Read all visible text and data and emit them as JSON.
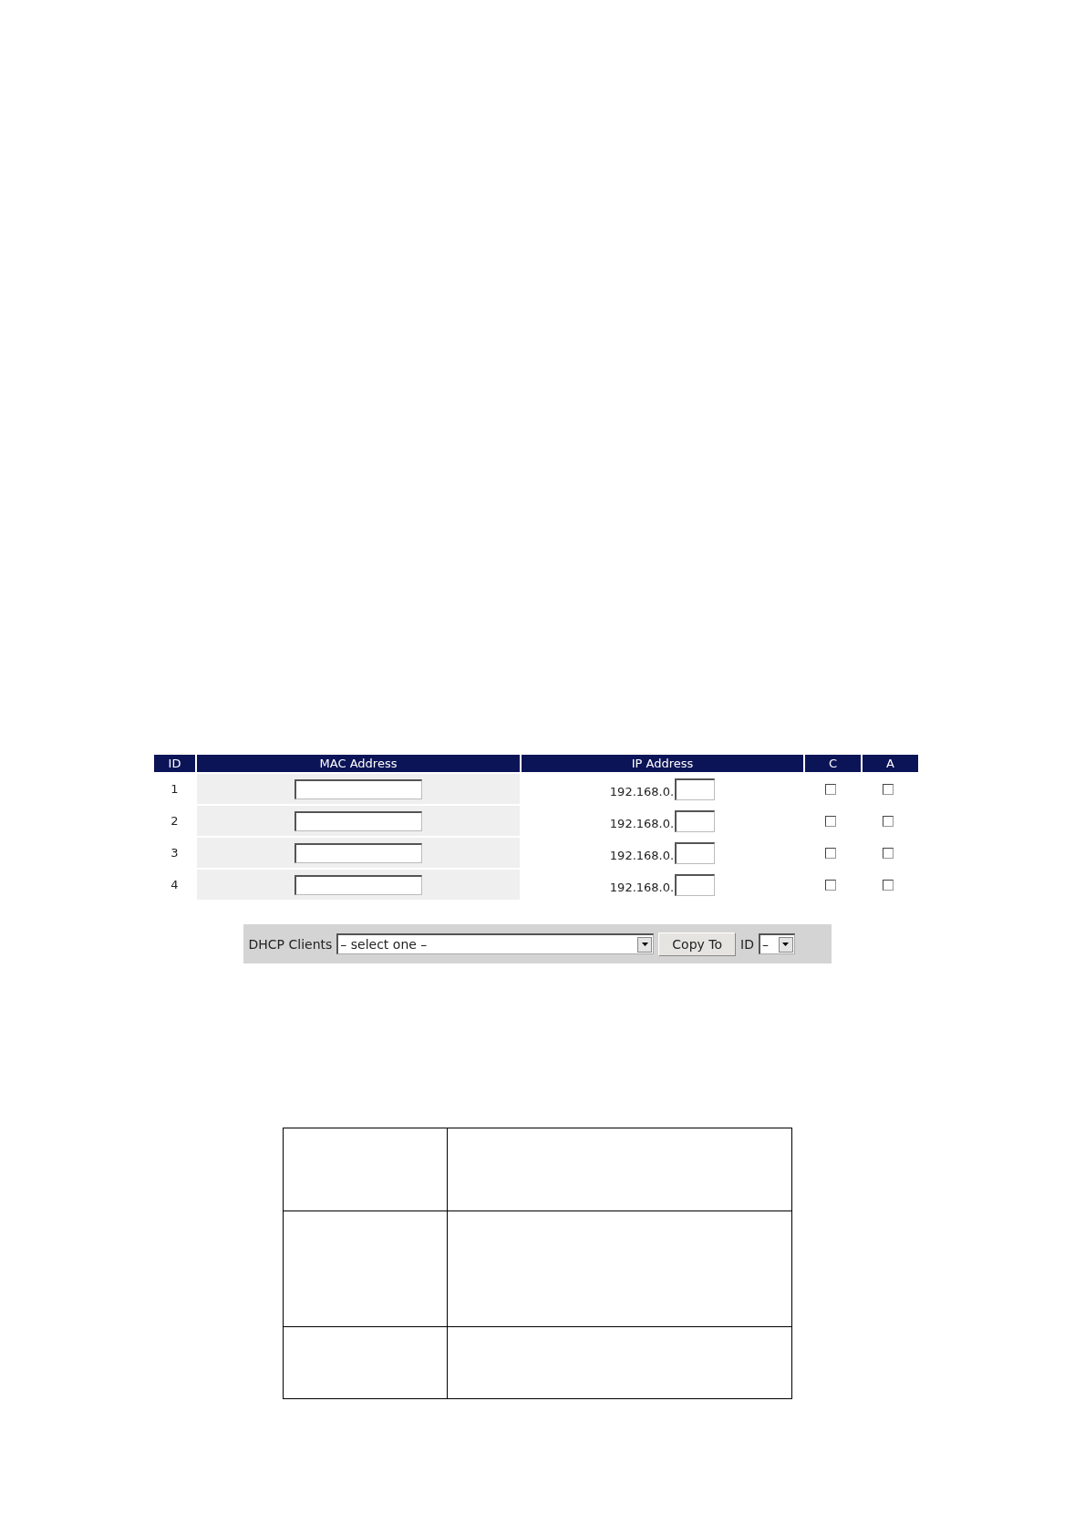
{
  "reservation_table": {
    "columns": [
      "ID",
      "MAC Address",
      "IP Address",
      "C",
      "A"
    ],
    "rows": [
      {
        "id": "1",
        "ip_prefix": "192.168.0.",
        "c_checked": false,
        "a_checked": false
      },
      {
        "id": "2",
        "ip_prefix": "192.168.0.",
        "c_checked": false,
        "a_checked": false
      },
      {
        "id": "3",
        "ip_prefix": "192.168.0.",
        "c_checked": false,
        "a_checked": false
      },
      {
        "id": "4",
        "ip_prefix": "192.168.0.",
        "c_checked": false,
        "a_checked": false
      }
    ]
  },
  "dhcp_bar": {
    "label": "DHCP Clients",
    "select_value": "– select one –",
    "button": "Copy To",
    "id_label": "ID",
    "id_value": "–"
  }
}
